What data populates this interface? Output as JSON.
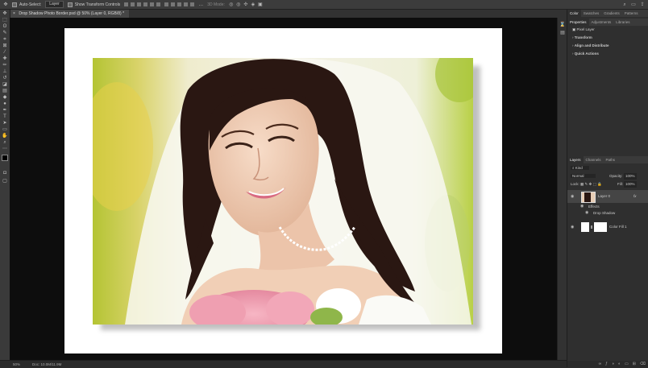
{
  "options_bar": {
    "auto_select_label": "Auto-Select:",
    "auto_select_value": "Layer",
    "transform_label": "Show Transform Controls",
    "mode_3d_label": "3D Mode:"
  },
  "document": {
    "tab_title": "Drop Shadow Photo Border.psd @ 50% (Layer 0, RGB/8) *"
  },
  "status_bar": {
    "zoom": "50%",
    "doc_info": "Doc: 10.0M/11.9M"
  },
  "right_panel": {
    "top_tabs": [
      "Color",
      "Swatches",
      "Gradients",
      "Patterns"
    ],
    "props_tabs": [
      "Properties",
      "Adjustments",
      "Libraries"
    ],
    "pixel_layer": "Pixel Layer",
    "sections": [
      "Transform",
      "Align and Distribute",
      "Quick Actions"
    ],
    "layers_tabs": [
      "Layers",
      "Channels",
      "Paths"
    ],
    "kind_filter": "Kind",
    "blend_mode": "Normal",
    "opacity_label": "Opacity:",
    "opacity_value": "100%",
    "lock_label": "Lock:",
    "fill_label": "Fill:",
    "fill_value": "100%",
    "layers": [
      {
        "name": "Layer 0",
        "fx": "fx"
      },
      {
        "name": "Effects"
      },
      {
        "name": "Drop Shadow"
      },
      {
        "name": "Color Fill 1"
      }
    ]
  },
  "colors": {
    "app_bg": "#2b2b2b",
    "canvas_bg": "#0d0d0d",
    "paper": "#ffffff",
    "panel": "#2f2f2f"
  }
}
